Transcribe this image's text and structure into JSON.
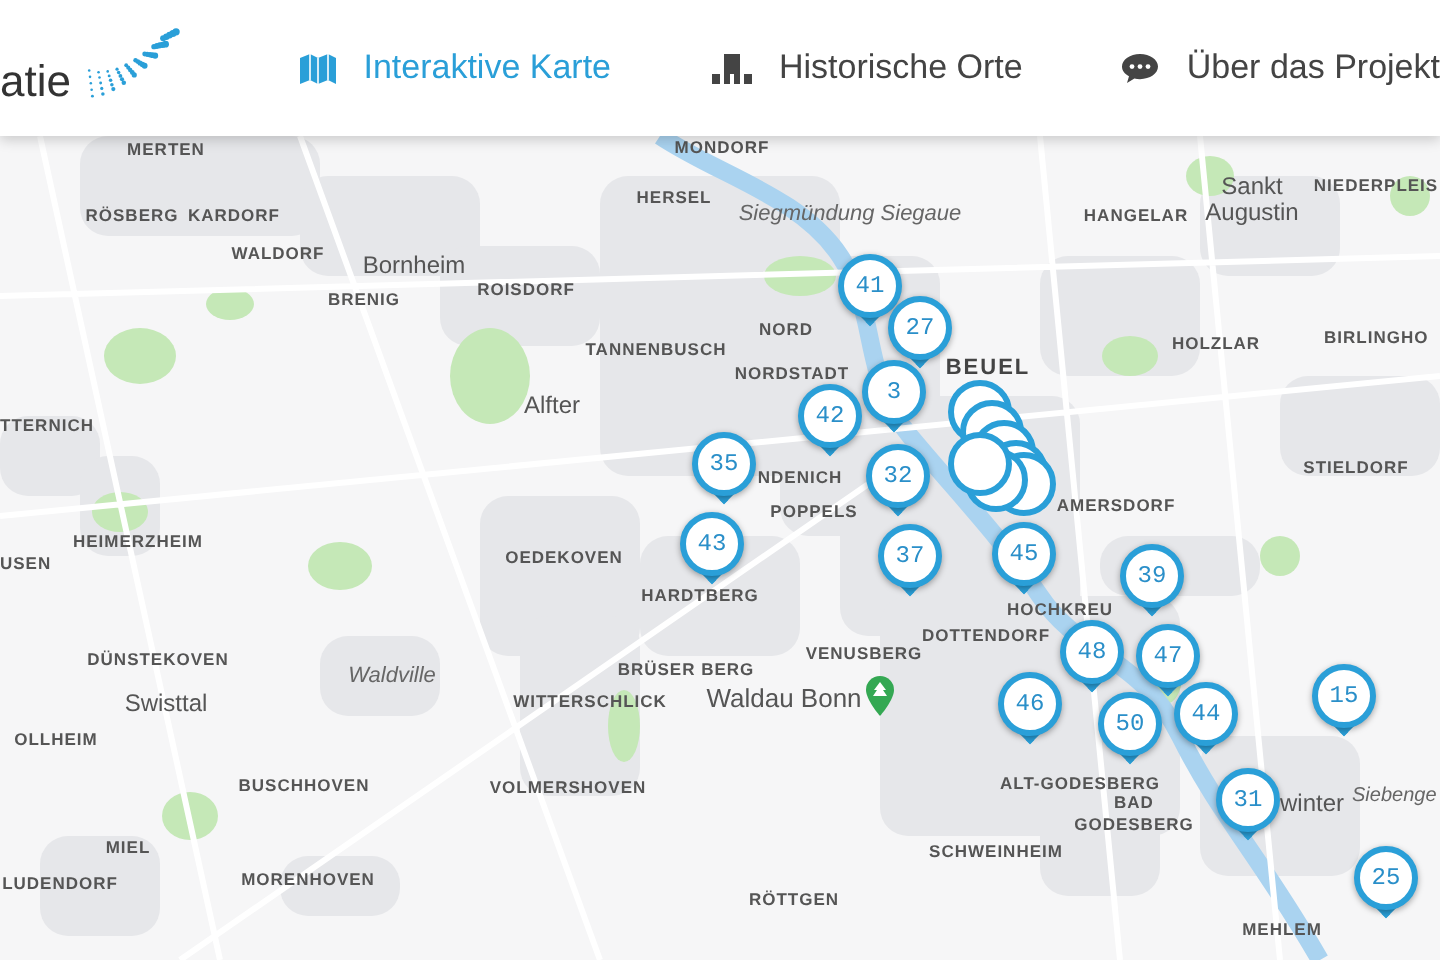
{
  "header": {
    "logo_text": "atie",
    "nav": [
      {
        "label": "Interaktive Karte",
        "selected": true
      },
      {
        "label": "Historische Orte",
        "selected": false
      },
      {
        "label": "Über das Projekt",
        "selected": false
      }
    ]
  },
  "map": {
    "place_labels": [
      {
        "text": "MONDORF",
        "kind": "town"
      },
      {
        "text": "MERTEN",
        "kind": "town"
      },
      {
        "text": "RÖSBERG",
        "kind": "town"
      },
      {
        "text": "KARDORF",
        "kind": "town"
      },
      {
        "text": "HERSEL",
        "kind": "town"
      },
      {
        "text": "Siegmündung Siegaue",
        "kind": "area"
      },
      {
        "text": "HANGELAR",
        "kind": "town"
      },
      {
        "text": "Sankt Augustin",
        "kind": "city"
      },
      {
        "text": "NIEDERPLEIS",
        "kind": "town"
      },
      {
        "text": "WALDORF",
        "kind": "town"
      },
      {
        "text": "Bornheim",
        "kind": "city"
      },
      {
        "text": "ROISDORF",
        "kind": "town"
      },
      {
        "text": "BRENIG",
        "kind": "town"
      },
      {
        "text": "NORD",
        "kind": "town"
      },
      {
        "text": "TANNENBUSCH",
        "kind": "town"
      },
      {
        "text": "HOLZLAR",
        "kind": "town"
      },
      {
        "text": "BIRLINGHO",
        "kind": "town"
      },
      {
        "text": "NORDSTADT",
        "kind": "town"
      },
      {
        "text": "BEUEL",
        "kind": "district"
      },
      {
        "text": "TTERNICH",
        "kind": "town"
      },
      {
        "text": "Alfter",
        "kind": "city"
      },
      {
        "text": "NDENICH",
        "kind": "town"
      },
      {
        "text": "STIELDORF",
        "kind": "town"
      },
      {
        "text": "AMERSDORF",
        "kind": "town"
      },
      {
        "text": "POPPELS",
        "kind": "town"
      },
      {
        "text": "HEIMERZHEIM",
        "kind": "town"
      },
      {
        "text": "USEN",
        "kind": "town"
      },
      {
        "text": "OEDEKOVEN",
        "kind": "town"
      },
      {
        "text": "HARDTBERG",
        "kind": "town"
      },
      {
        "text": "HOCHKREU",
        "kind": "town"
      },
      {
        "text": "DOTTENDORF",
        "kind": "town"
      },
      {
        "text": "VENUSBERG",
        "kind": "town"
      },
      {
        "text": "DÜNSTEKOVEN",
        "kind": "town"
      },
      {
        "text": "Waldville",
        "kind": "area"
      },
      {
        "text": "BRÜSER BERG",
        "kind": "town"
      },
      {
        "text": "Swisttal",
        "kind": "city"
      },
      {
        "text": "WITTERSCHLICK",
        "kind": "town"
      },
      {
        "text": "Waldau Bonn",
        "kind": "park"
      },
      {
        "text": "OLLHEIM",
        "kind": "town"
      },
      {
        "text": "BUSCHHOVEN",
        "kind": "town"
      },
      {
        "text": "VOLMERSHOVEN",
        "kind": "town"
      },
      {
        "text": "ALT-GODESBERG",
        "kind": "town"
      },
      {
        "text": "BAD GODESBERG",
        "kind": "town"
      },
      {
        "text": "winter",
        "kind": "city"
      },
      {
        "text": "Siebenge",
        "kind": "area"
      },
      {
        "text": "SCHWEINHEIM",
        "kind": "town"
      },
      {
        "text": "MIEL",
        "kind": "town"
      },
      {
        "text": "LUDENDORF",
        "kind": "town"
      },
      {
        "text": "MORENHOVEN",
        "kind": "town"
      },
      {
        "text": "RÖTTGEN",
        "kind": "town"
      },
      {
        "text": "MEHLEM",
        "kind": "town"
      }
    ],
    "markers": [
      {
        "label": "41"
      },
      {
        "label": "27"
      },
      {
        "label": "3"
      },
      {
        "label": "42"
      },
      {
        "label": "35"
      },
      {
        "label": "43"
      },
      {
        "label": "32"
      },
      {
        "label": "37"
      },
      {
        "label": "45"
      },
      {
        "label": "39"
      },
      {
        "label": "48"
      },
      {
        "label": "47"
      },
      {
        "label": "46"
      },
      {
        "label": "44"
      },
      {
        "label": "50"
      },
      {
        "label": "31"
      },
      {
        "label": "15"
      },
      {
        "label": "25"
      }
    ]
  }
}
